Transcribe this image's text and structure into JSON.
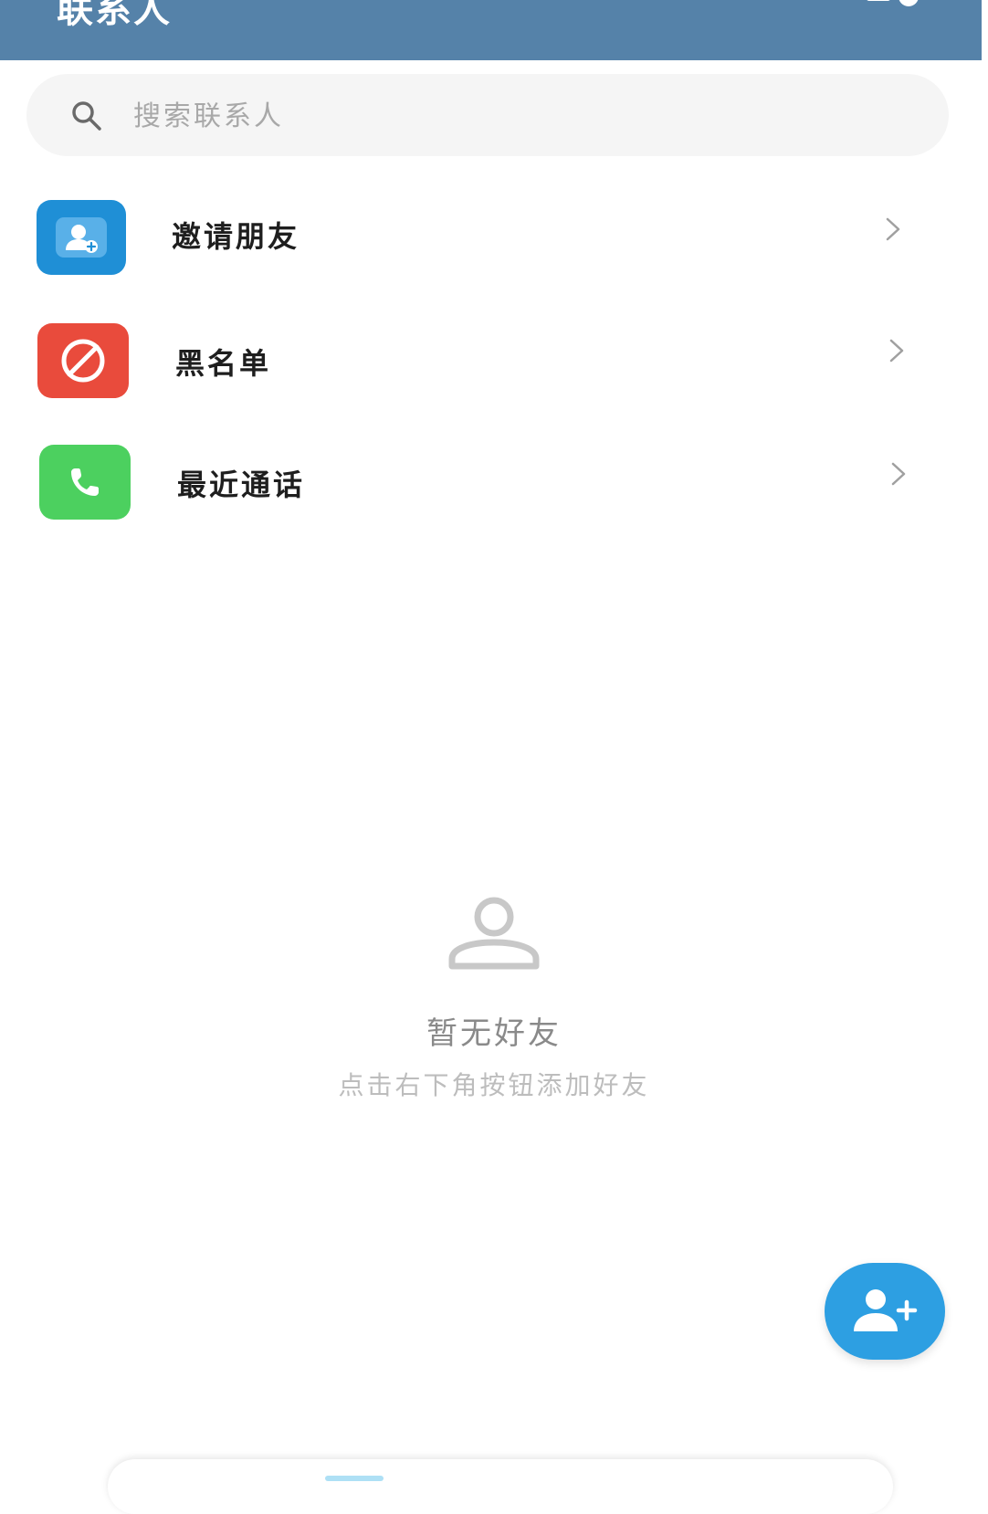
{
  "header": {
    "title": "联系人",
    "background": "#5582a9"
  },
  "search": {
    "placeholder": "搜索联系人",
    "value": ""
  },
  "menu": {
    "items": [
      {
        "label": "邀请朋友",
        "icon": "invite-user-icon",
        "color": "#1f8fd6"
      },
      {
        "label": "黑名单",
        "icon": "block-icon",
        "color": "#e94b3c"
      },
      {
        "label": "最近通话",
        "icon": "phone-icon",
        "color": "#4cd05f"
      }
    ]
  },
  "empty_state": {
    "title": "暂无好友",
    "subtitle": "点击右下角按钮添加好友",
    "icon": "person-outline-icon"
  },
  "fab": {
    "icon": "add-user-icon",
    "color": "#2d9fe2"
  }
}
